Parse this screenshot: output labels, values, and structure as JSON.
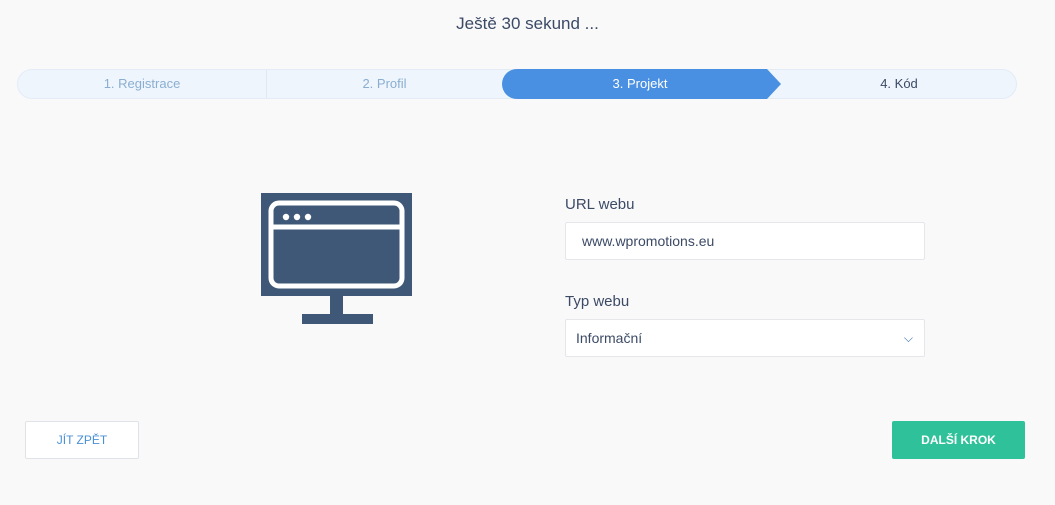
{
  "header": {
    "title": "Ještě 30 sekund ..."
  },
  "stepper": {
    "steps": [
      {
        "label": "1. Registrace"
      },
      {
        "label": "2. Profil"
      },
      {
        "label": "3. Projekt"
      },
      {
        "label": "4. Kód"
      }
    ],
    "active_step": 3
  },
  "illustration": {
    "icon": "monitor-browser-icon"
  },
  "form": {
    "url": {
      "label": "URL webu",
      "value": "www.wpromotions.eu"
    },
    "type": {
      "label": "Typ webu",
      "value": "Informační",
      "icon": "chevron-down-icon"
    }
  },
  "actions": {
    "back_label": "JÍT ZPĚT",
    "next_label": "DALŠÍ KROK"
  },
  "colors": {
    "accent": "#4a90e2",
    "success": "#2fc19a",
    "icon": "#3f5878"
  }
}
